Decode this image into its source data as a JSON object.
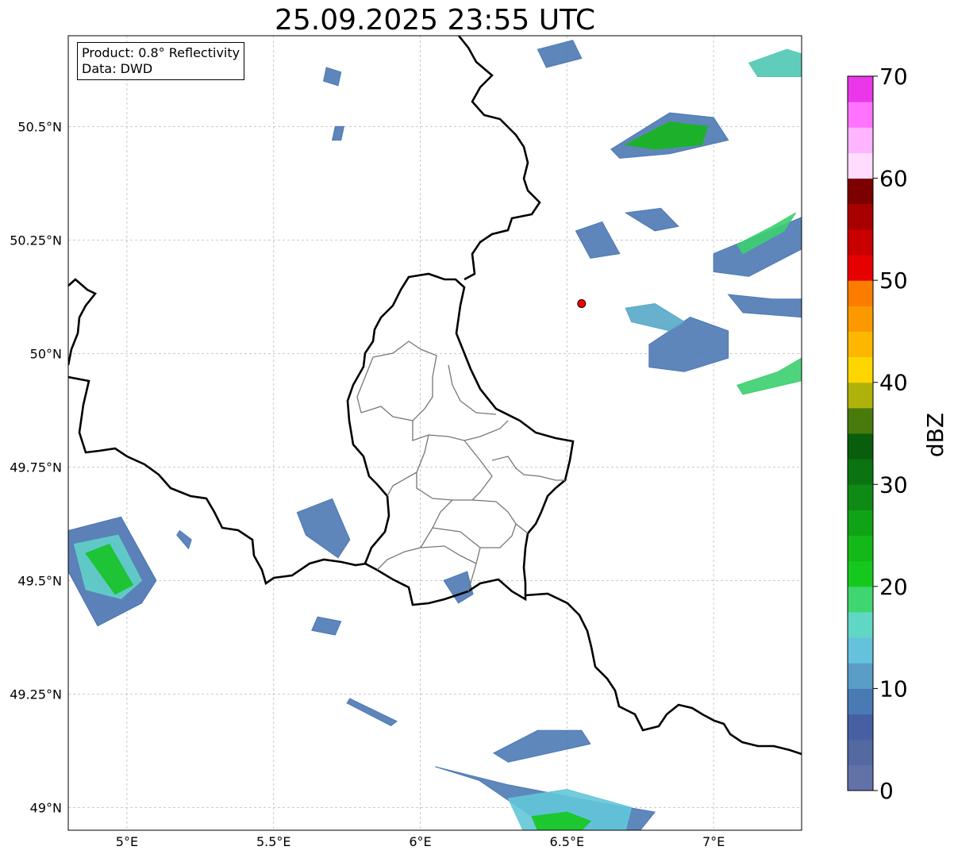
{
  "map": {
    "title": "25.09.2025 23:55 UTC",
    "info": {
      "product": "Product: 0.8° Reflectivity",
      "data": "Data: DWD"
    },
    "extent": {
      "lon": [
        4.8,
        7.3
      ],
      "lat": [
        48.95,
        50.7
      ]
    },
    "gridlines": true,
    "x_ticks": [
      {
        "lon": 5.0,
        "label": "5°E"
      },
      {
        "lon": 5.5,
        "label": "5.5°E"
      },
      {
        "lon": 6.0,
        "label": "6°E"
      },
      {
        "lon": 6.5,
        "label": "6.5°E"
      },
      {
        "lon": 7.0,
        "label": "7°E"
      }
    ],
    "y_ticks": [
      {
        "lat": 49.0,
        "label": "49°N"
      },
      {
        "lat": 49.25,
        "label": "49.25°N"
      },
      {
        "lat": 49.5,
        "label": "49.5°N"
      },
      {
        "lat": 49.75,
        "label": "49.75°N"
      },
      {
        "lat": 50.0,
        "label": "50°N"
      },
      {
        "lat": 50.25,
        "label": "50.25°N"
      },
      {
        "lat": 50.5,
        "label": "50.5°N"
      }
    ],
    "radar_site": {
      "lon": 6.55,
      "lat": 50.11,
      "color": "#ff0000"
    },
    "colorbar": {
      "label": "dBZ",
      "min": 0,
      "max": 70,
      "step": 2.5,
      "tick_values": [
        0,
        10,
        20,
        30,
        40,
        50,
        60,
        70
      ],
      "tick_labels": [
        "0",
        "10",
        "20",
        "30",
        "40",
        "50",
        "60",
        "70"
      ],
      "colors": [
        "#6272a8",
        "#5468a2",
        "#4660a3",
        "#4a7ab3",
        "#5a9ec8",
        "#64c2dd",
        "#60d6c4",
        "#3fd672",
        "#16c81e",
        "#14b818",
        "#11a316",
        "#0f8a14",
        "#0b7410",
        "#085e0c",
        "#487a0c",
        "#aeb20a",
        "#fdd600",
        "#fdb700",
        "#fc9900",
        "#fc7c00",
        "#e60000",
        "#c80000",
        "#a80000",
        "#7d0000",
        "#ffdcff",
        "#ffb4ff",
        "#ff73ff",
        "#ea37ea"
      ]
    },
    "echoes": [
      {
        "name": "echo-bottom-south",
        "lon": [
          6.05,
          6.3,
          6.62,
          6.8,
          6.75,
          6.45,
          6.2
        ],
        "lat": [
          49.09,
          49.05,
          49.01,
          48.99,
          48.95,
          48.95,
          49.06
        ],
        "color": "#4d7ab5"
      },
      {
        "name": "echo-bottom-south-2",
        "lon": [
          6.25,
          6.4,
          6.55,
          6.58,
          6.3
        ],
        "lat": [
          49.12,
          49.17,
          49.17,
          49.14,
          49.1
        ],
        "color": "#4d7ab5"
      },
      {
        "name": "echo-bottom-core",
        "lon": [
          6.3,
          6.5,
          6.72,
          6.7,
          6.35
        ],
        "lat": [
          49.02,
          49.04,
          49.0,
          48.95,
          48.95
        ],
        "color": "#63c6d8"
      },
      {
        "name": "echo-bottom-green",
        "lon": [
          6.38,
          6.5,
          6.58,
          6.55,
          6.4
        ],
        "lat": [
          48.98,
          48.99,
          48.97,
          48.95,
          48.95
        ],
        "color": "#16c81e"
      },
      {
        "name": "echo-west",
        "lon": [
          4.8,
          4.98,
          5.1,
          5.05,
          4.9,
          4.8
        ],
        "lat": [
          49.61,
          49.64,
          49.5,
          49.45,
          49.4,
          49.52
        ],
        "color": "#4a73b0"
      },
      {
        "name": "echo-west-core",
        "lon": [
          4.82,
          4.97,
          5.05,
          4.98,
          4.86
        ],
        "lat": [
          49.58,
          49.6,
          49.5,
          49.46,
          49.48
        ],
        "color": "#60cfc8"
      },
      {
        "name": "echo-west-green",
        "lon": [
          4.86,
          4.94,
          5.02,
          4.96
        ],
        "lat": [
          49.56,
          49.58,
          49.49,
          49.47
        ],
        "color": "#18c326"
      },
      {
        "name": "echo-mid-west",
        "lon": [
          5.58,
          5.7,
          5.76,
          5.72,
          5.61
        ],
        "lat": [
          49.65,
          49.68,
          49.59,
          49.55,
          49.6
        ],
        "color": "#4d79b4"
      },
      {
        "name": "echo-south-lux",
        "lon": [
          6.08,
          6.16,
          6.18,
          6.13,
          6.1
        ],
        "lat": [
          49.5,
          49.52,
          49.47,
          49.45,
          49.48
        ],
        "color": "#4d79b4"
      },
      {
        "name": "echo-small-1",
        "lon": [
          5.65,
          5.73,
          5.71,
          5.63
        ],
        "lat": [
          49.42,
          49.41,
          49.38,
          49.39
        ],
        "color": "#4d79b4"
      },
      {
        "name": "echo-small-2",
        "lon": [
          5.76,
          5.92,
          5.9,
          5.75
        ],
        "lat": [
          49.24,
          49.19,
          49.18,
          49.23
        ],
        "color": "#4d79b4"
      },
      {
        "name": "echo-small-3",
        "lon": [
          5.18,
          5.22,
          5.21,
          5.17
        ],
        "lat": [
          49.61,
          49.59,
          49.57,
          49.6
        ],
        "color": "#4d79b4"
      },
      {
        "name": "echo-ne-cluster",
        "lon": [
          6.65,
          6.85,
          7.0,
          7.05,
          6.85,
          6.68
        ],
        "lat": [
          50.45,
          50.53,
          50.52,
          50.47,
          50.44,
          50.43
        ],
        "color": "#4d79b4"
      },
      {
        "name": "echo-ne-green",
        "lon": [
          6.7,
          6.85,
          6.98,
          6.96,
          6.8
        ],
        "lat": [
          50.46,
          50.51,
          50.5,
          50.46,
          50.45
        ],
        "color": "#16b61c"
      },
      {
        "name": "echo-ne-top-1",
        "lon": [
          6.4,
          6.52,
          6.55,
          6.43
        ],
        "lat": [
          50.67,
          50.69,
          50.65,
          50.63
        ],
        "color": "#4d79b4"
      },
      {
        "name": "echo-ne-top-2",
        "lon": [
          7.12,
          7.25,
          7.3,
          7.3,
          7.15
        ],
        "lat": [
          50.64,
          50.67,
          50.66,
          50.61,
          50.61
        ],
        "color": "#4fc8b2"
      },
      {
        "name": "echo-east-1",
        "lon": [
          7.0,
          7.15,
          7.3,
          7.3,
          7.12,
          7.0
        ],
        "lat": [
          50.22,
          50.26,
          50.3,
          50.23,
          50.17,
          50.18
        ],
        "color": "#4d79b4"
      },
      {
        "name": "echo-east-green",
        "lon": [
          7.08,
          7.2,
          7.28,
          7.24,
          7.1
        ],
        "lat": [
          50.24,
          50.28,
          50.31,
          50.27,
          50.22
        ],
        "color": "#3ccf70"
      },
      {
        "name": "echo-east-2",
        "lon": [
          6.78,
          6.92,
          7.05,
          7.05,
          6.9,
          6.78
        ],
        "lat": [
          50.02,
          50.08,
          50.05,
          49.99,
          49.96,
          49.97
        ],
        "color": "#4d79b4"
      },
      {
        "name": "echo-east-3",
        "lon": [
          7.05,
          7.2,
          7.3,
          7.3,
          7.1
        ],
        "lat": [
          50.13,
          50.12,
          50.12,
          50.08,
          50.09
        ],
        "color": "#4d79b4"
      },
      {
        "name": "echo-east-4",
        "lon": [
          7.08,
          7.22,
          7.3,
          7.3,
          7.1
        ],
        "lat": [
          49.93,
          49.96,
          49.99,
          49.94,
          49.91
        ],
        "color": "#3ccf70"
      },
      {
        "name": "echo-mid-east",
        "lon": [
          6.53,
          6.62,
          6.68,
          6.58
        ],
        "lat": [
          50.27,
          50.29,
          50.22,
          50.21
        ],
        "color": "#4d79b4"
      },
      {
        "name": "echo-east-5",
        "lon": [
          6.7,
          6.82,
          6.88,
          6.8
        ],
        "lat": [
          50.31,
          50.32,
          50.28,
          50.27
        ],
        "color": "#4d79b4"
      },
      {
        "name": "echo-east-6",
        "lon": [
          6.7,
          6.8,
          6.9,
          6.85,
          6.72
        ],
        "lat": [
          50.1,
          50.11,
          50.07,
          50.05,
          50.07
        ],
        "color": "#56a8c8"
      },
      {
        "name": "echo-topcenter",
        "lon": [
          5.68,
          5.73,
          5.72,
          5.67
        ],
        "lat": [
          50.63,
          50.62,
          50.59,
          50.6
        ],
        "color": "#4d79b4"
      },
      {
        "name": "echo-topcenter-2",
        "lon": [
          5.71,
          5.74,
          5.73,
          5.7
        ],
        "lat": [
          50.5,
          50.5,
          50.47,
          50.47
        ],
        "color": "#4d79b4"
      }
    ]
  }
}
